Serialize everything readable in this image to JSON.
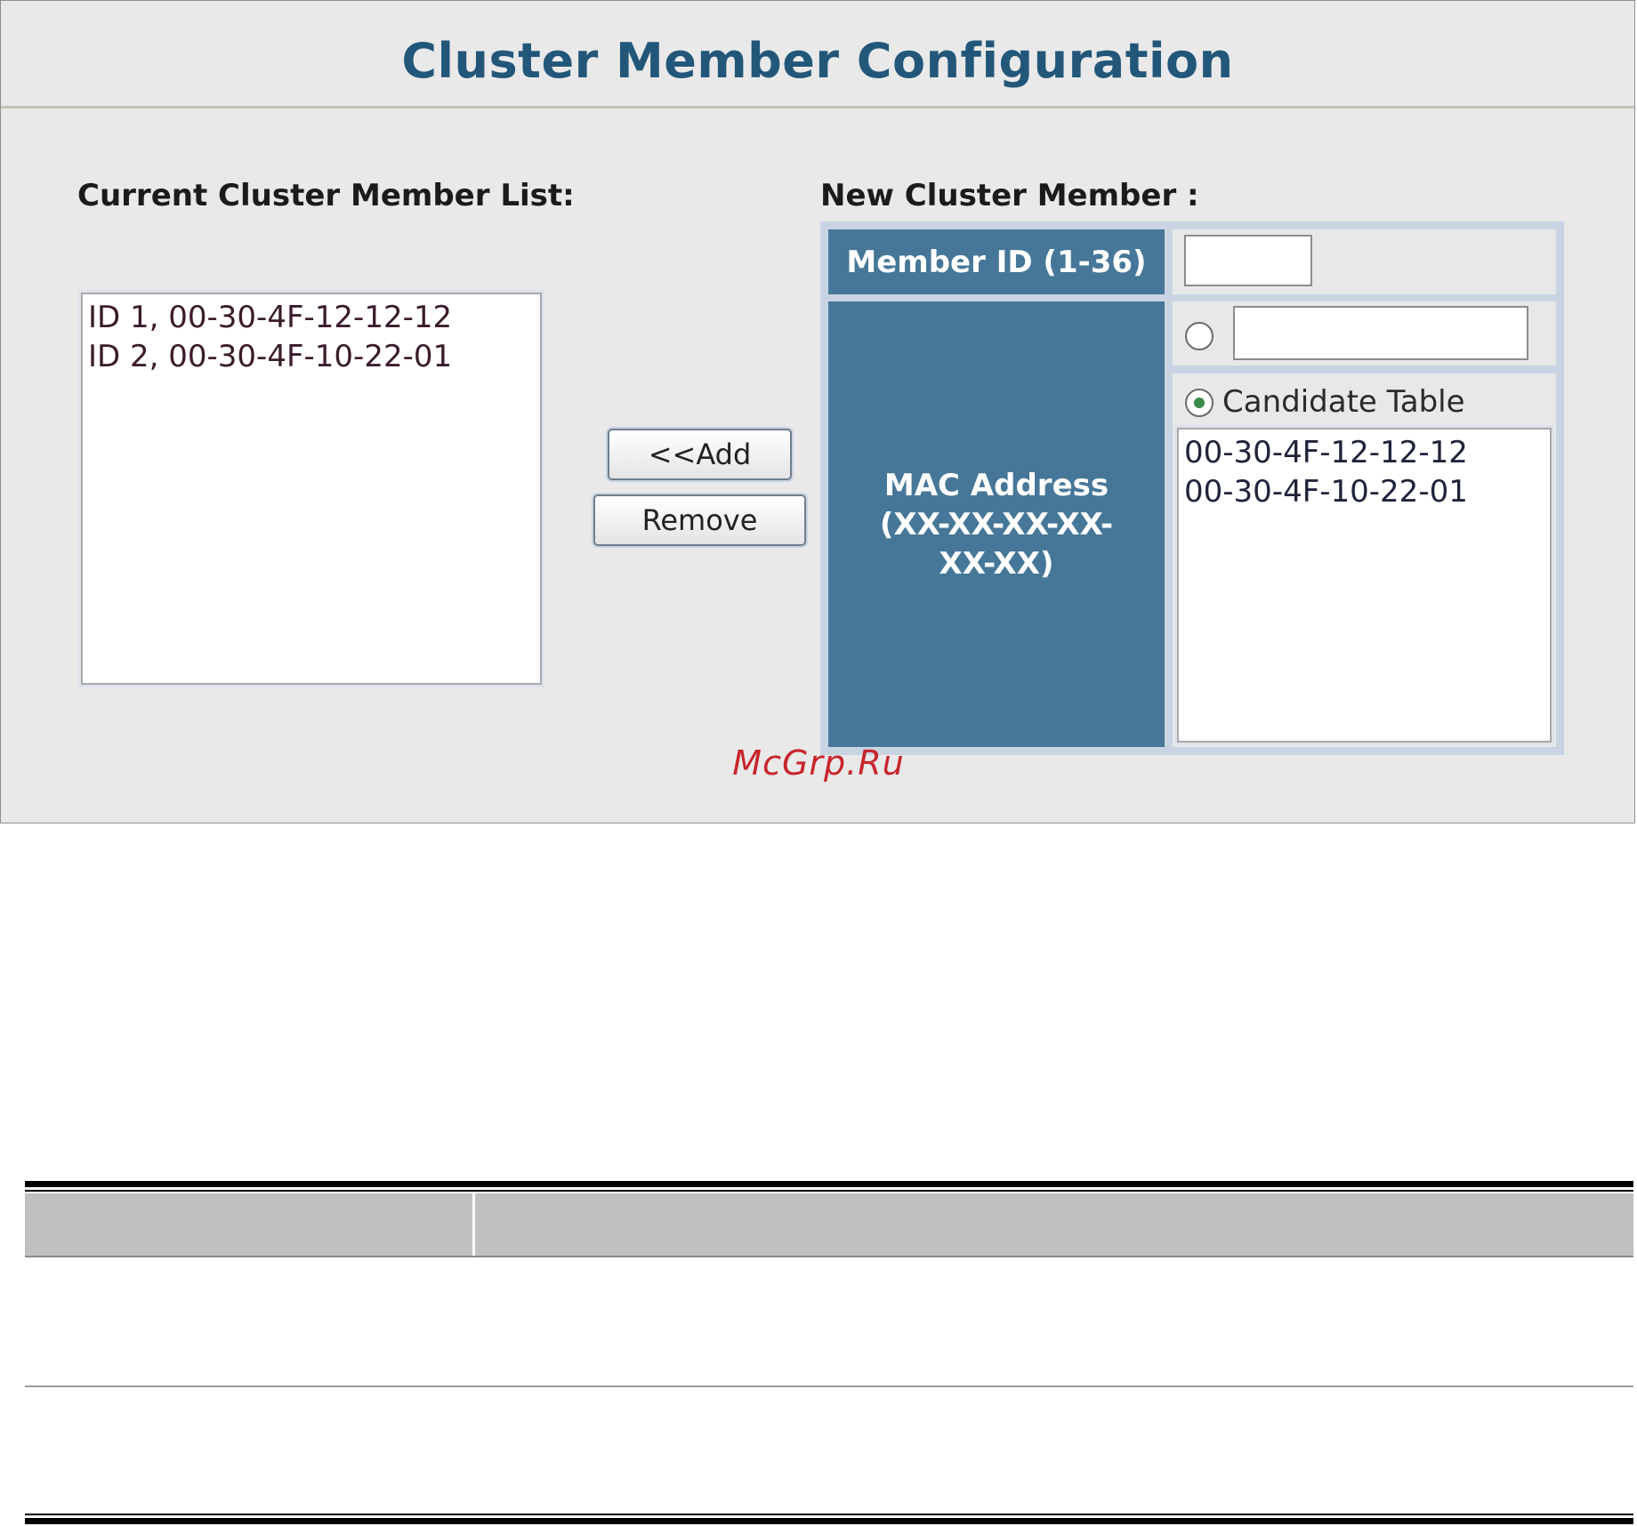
{
  "panel": {
    "title": "Cluster Member Configuration",
    "current_list_label": "Current Cluster Member List:",
    "new_member_label": "New Cluster Member :",
    "current_members": [
      "ID 1, 00-30-4F-12-12-12",
      "ID 2, 00-30-4F-10-22-01"
    ],
    "buttons": {
      "add_label": "<<Add",
      "remove_label": "Remove"
    },
    "form": {
      "member_id_label": "Member ID (1-36)",
      "member_id_value": "",
      "mac_label_line1": "MAC Address",
      "mac_label_line2": "(XX-XX-XX-XX-",
      "mac_label_line3": "XX-XX)",
      "mac_manual_value": "",
      "candidate_label": "Candidate Table",
      "selected_source": "candidate",
      "candidates": [
        "00-30-4F-12-12-12",
        "00-30-4F-10-22-01"
      ]
    },
    "watermark": "McGrp.Ru"
  },
  "colors": {
    "title": "#22577a",
    "header_cell": "#467798",
    "panel_bg": "#e9e9e9",
    "watermark": "#c8252c"
  },
  "doc_table": {
    "headers": [
      "",
      ""
    ],
    "rows": [
      [
        "",
        ""
      ],
      [
        "",
        ""
      ]
    ]
  }
}
